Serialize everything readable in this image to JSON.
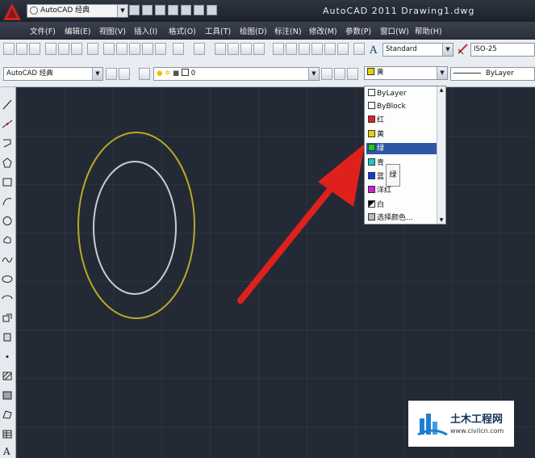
{
  "title_bar": {
    "workspace": "AutoCAD 经典",
    "window_title": "AutoCAD 2011    Drawing1.dwg"
  },
  "menu": [
    "文件(F)",
    "编辑(E)",
    "视图(V)",
    "插入(I)",
    "格式(O)",
    "工具(T)",
    "绘图(D)",
    "标注(N)",
    "修改(M)",
    "参数(P)",
    "窗口(W)",
    "帮助(H)"
  ],
  "styles": {
    "text_style": "Standard",
    "dim_style": "ISO-25"
  },
  "layers_toolbar": {
    "workspace": "AutoCAD 经典",
    "layer": "0"
  },
  "properties": {
    "color_current": "黄",
    "linetype": "ByLayer"
  },
  "color_dropdown": {
    "options": [
      {
        "label": "ByLayer",
        "swatch": "#ffffff"
      },
      {
        "label": "ByBlock",
        "swatch": "#ffffff"
      },
      {
        "label": "红",
        "swatch": "#e02020"
      },
      {
        "label": "黄",
        "swatch": "#e6d400"
      },
      {
        "label": "绿",
        "swatch": "#1ec81e",
        "selected": true
      },
      {
        "label": "青",
        "swatch": "#18c8c8"
      },
      {
        "label": "蓝",
        "swatch": "#1838d8"
      },
      {
        "label": "洋红",
        "swatch": "#d020d0"
      },
      {
        "label": "白",
        "swatch": "#000000"
      },
      {
        "label": "选择颜色...",
        "swatch": "#bbbbbb"
      }
    ],
    "tooltip": "绿"
  },
  "colors": {
    "outer_circle": "#b9a828",
    "inner_circle": "#c9cdd6",
    "arrow": "#e0201c"
  },
  "watermark": {
    "brand": "土木工程网",
    "url": "www.civilcn.com"
  }
}
